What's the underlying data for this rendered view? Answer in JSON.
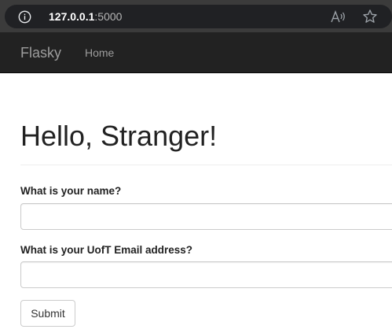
{
  "browser": {
    "url_host": "127.0.0.1",
    "url_port": ":5000",
    "icons": [
      "info-icon",
      "read-aloud-icon",
      "favorite-star-icon"
    ]
  },
  "navbar": {
    "brand": "Flasky",
    "home_label": "Home"
  },
  "page": {
    "title": "Hello, Stranger!"
  },
  "form": {
    "name_label": "What is your name?",
    "name_value": "",
    "email_label": "What is your UofT Email address?",
    "email_value": "",
    "submit_label": "Submit"
  },
  "colors": {
    "navbar_bg": "#222222",
    "navbar_text": "#9d9d9d",
    "browser_bar": "#3b3b3b"
  }
}
